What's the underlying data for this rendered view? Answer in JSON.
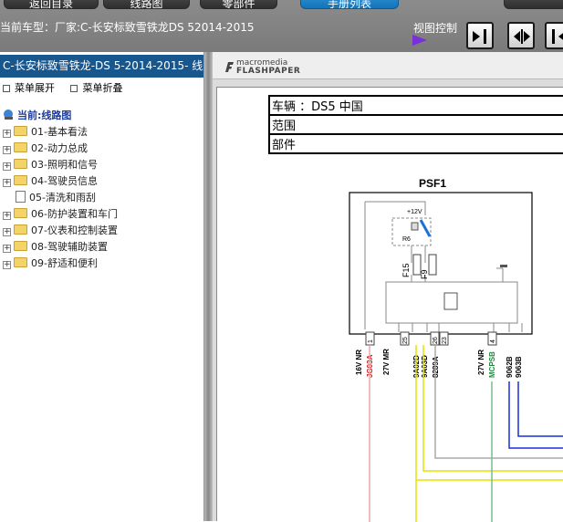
{
  "topbar": {
    "buttons": [
      {
        "label": "返回目录",
        "active": false
      },
      {
        "label": "线路图",
        "active": false
      },
      {
        "label": "零部件",
        "active": false
      },
      {
        "label": "手册列表",
        "active": true
      },
      {
        "label": "",
        "active": false
      }
    ],
    "car_model_label": "当前车型：厂家:C-长安标致雪铁龙DS 52014-2015",
    "view_control_label": "视图控制"
  },
  "sidebar": {
    "title": "C-长安标致雪铁龙-DS 5-2014-2015- 线路",
    "expand_label": "菜单展开",
    "collapse_label": "菜单折叠",
    "root_label": "当前:线路图",
    "items": [
      {
        "label": "01-基本看法",
        "expandable": true
      },
      {
        "label": "02-动力总成",
        "expandable": true
      },
      {
        "label": "03-照明和信号",
        "expandable": true
      },
      {
        "label": "04-驾驶员信息",
        "expandable": true
      },
      {
        "label": "05-清洗和雨刮",
        "expandable": false
      },
      {
        "label": "06-防护装置和车门",
        "expandable": true
      },
      {
        "label": "07-仪表和控制装置",
        "expandable": true
      },
      {
        "label": "08-驾驶辅助装置",
        "expandable": true
      },
      {
        "label": "09-舒适和便利",
        "expandable": true
      }
    ]
  },
  "viewer": {
    "brand_top": "macromedia",
    "brand_bottom": "FLASHPAPER",
    "info_rows": [
      "车辆 ：DS5 中国",
      "范围",
      "部件"
    ],
    "diagram": {
      "component": "PSF1",
      "voltage": "+12V",
      "relay": "R6",
      "fuses": [
        "F15",
        "F9"
      ],
      "pins": [
        "1",
        "25",
        "26",
        "23",
        "4"
      ],
      "wires": [
        "JG03A",
        "9A02D",
        "9A03D",
        "8289A",
        "MCPSB",
        "9062B",
        "9063B"
      ],
      "connectors": [
        "16V NR",
        "27V MR",
        "27V NR"
      ]
    }
  }
}
